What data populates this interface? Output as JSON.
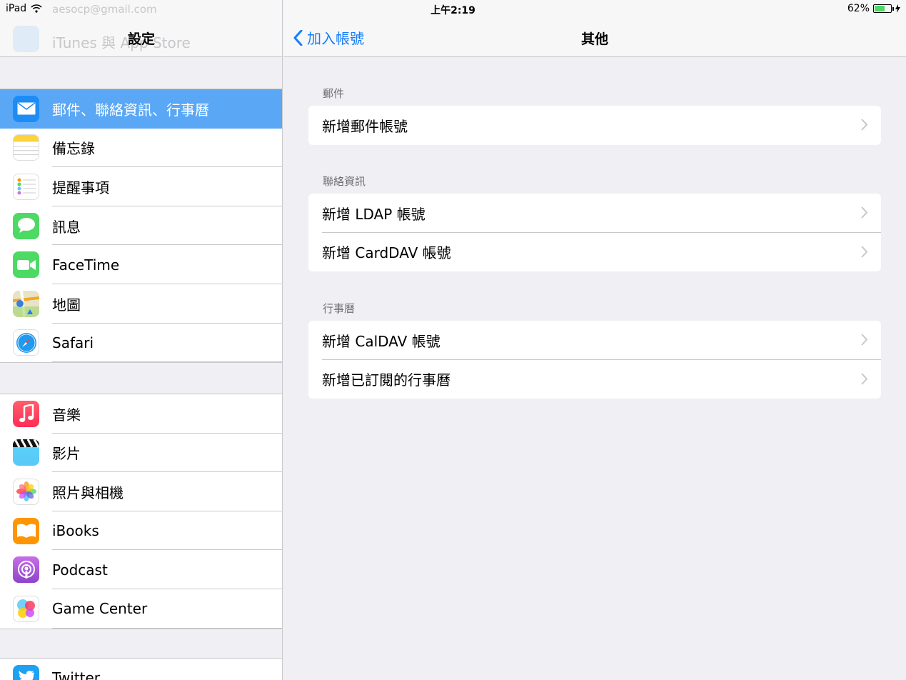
{
  "status_bar": {
    "device": "iPad",
    "time": "上午2:19",
    "battery_percent": "62%",
    "battery_level": 0.62
  },
  "left_panel": {
    "title": "設定",
    "ghost_email": "aesocp@gmail.com",
    "ghost_row": "iTunes 與 App Store",
    "group1": [
      {
        "label": "郵件、聯絡資訊、行事曆",
        "icon": "mail-icon",
        "selected": true
      },
      {
        "label": "備忘錄",
        "icon": "notes-icon"
      },
      {
        "label": "提醒事項",
        "icon": "reminders-icon"
      },
      {
        "label": "訊息",
        "icon": "messages-icon"
      },
      {
        "label": "FaceTime",
        "icon": "facetime-icon"
      },
      {
        "label": "地圖",
        "icon": "maps-icon"
      },
      {
        "label": "Safari",
        "icon": "safari-icon"
      }
    ],
    "group2": [
      {
        "label": "音樂",
        "icon": "music-icon"
      },
      {
        "label": "影片",
        "icon": "videos-icon"
      },
      {
        "label": "照片與相機",
        "icon": "photos-icon"
      },
      {
        "label": "iBooks",
        "icon": "ibooks-icon"
      },
      {
        "label": "Podcast",
        "icon": "podcast-icon"
      },
      {
        "label": "Game Center",
        "icon": "game-center-icon"
      }
    ],
    "group3": [
      {
        "label": "Twitter",
        "icon": "twitter-icon"
      }
    ]
  },
  "right_panel": {
    "back_label": "加入帳號",
    "title": "其他",
    "sections": [
      {
        "header": "郵件",
        "rows": [
          "新增郵件帳號"
        ]
      },
      {
        "header": "聯絡資訊",
        "rows": [
          "新增 LDAP 帳號",
          "新增 CardDAV 帳號"
        ]
      },
      {
        "header": "行事曆",
        "rows": [
          "新增 CalDAV 帳號",
          "新增已訂閱的行事曆"
        ]
      }
    ]
  },
  "colors": {
    "accent": "#157efb",
    "selected_row": "#5aa7f5",
    "background": "#efeff4"
  }
}
